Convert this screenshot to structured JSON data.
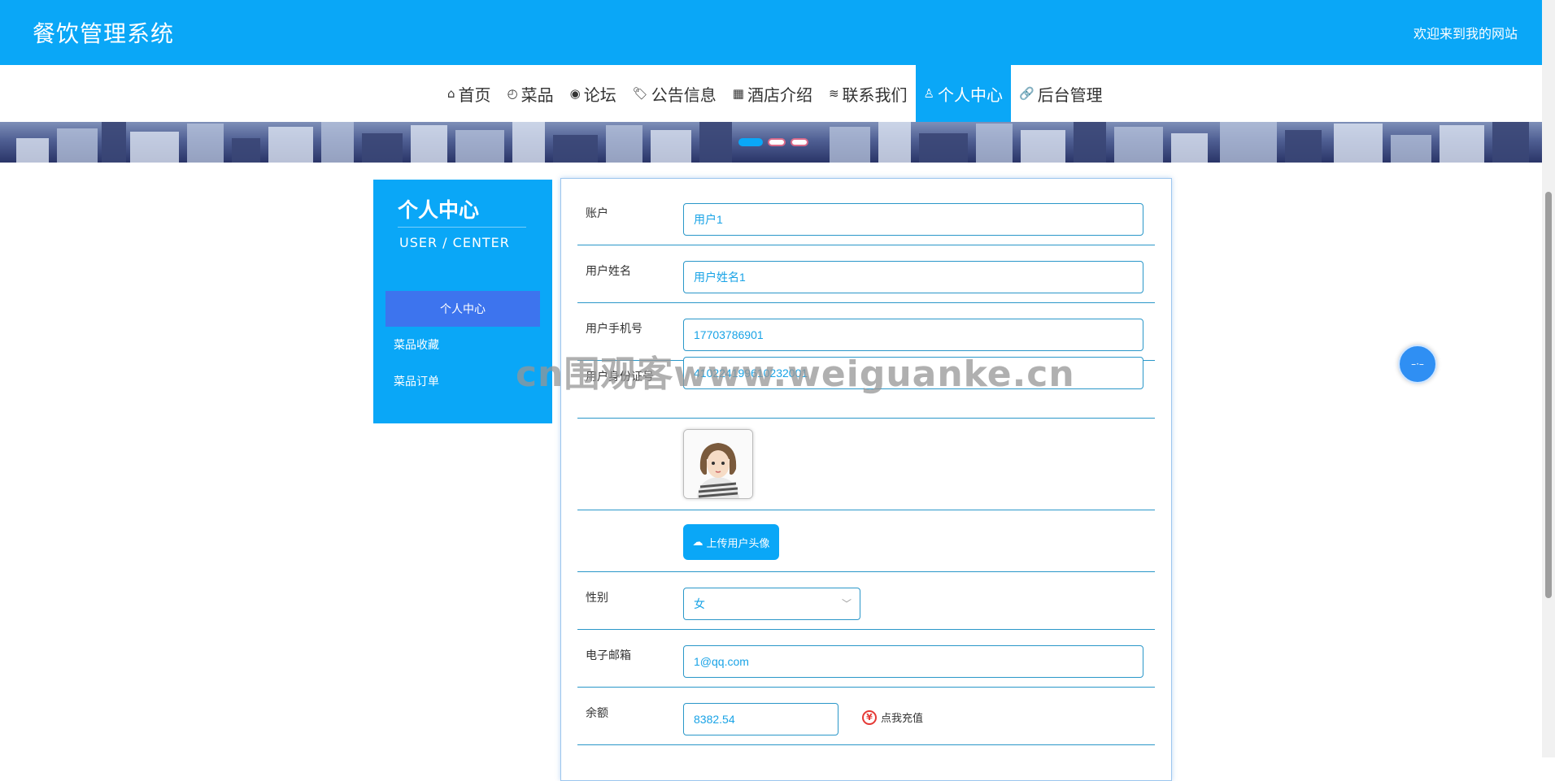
{
  "header": {
    "brand": "餐饮管理系统",
    "welcome": "欢迎来到我的网站"
  },
  "nav": [
    {
      "icon": "⌂",
      "label": "首页"
    },
    {
      "icon": "◴",
      "label": "菜品"
    },
    {
      "icon": "◉",
      "label": "论坛"
    },
    {
      "icon": "🏷",
      "label": "公告信息"
    },
    {
      "icon": "▦",
      "label": "酒店介绍"
    },
    {
      "icon": "≋",
      "label": "联系我们"
    },
    {
      "icon": "♙",
      "label": "个人中心",
      "active": true
    },
    {
      "icon": "🔗",
      "label": "后台管理"
    }
  ],
  "sidebar": {
    "title": "个人中心",
    "subtitle": "USER / CENTER",
    "items": [
      "个人中心",
      "菜品收藏",
      "菜品订单"
    ]
  },
  "form": {
    "account": {
      "label": "账户",
      "value": "用户1"
    },
    "name": {
      "label": "用户姓名",
      "value": "用户姓名1"
    },
    "phone": {
      "label": "用户手机号",
      "value": "17703786901"
    },
    "idcard": {
      "label": "用户身份证号",
      "value": "410224199610232001"
    },
    "upload_label": "上传用户头像",
    "gender": {
      "label": "性别",
      "value": "女"
    },
    "email": {
      "label": "电子邮箱",
      "value": "1@qq.com"
    },
    "balance": {
      "label": "余额",
      "value": "8382.54"
    },
    "recharge_label": "点我充值"
  },
  "watermark": "cn围观客www.weiguanke.cn",
  "icons": {
    "upload": "cloud-upload-icon",
    "recharge": "yen-icon",
    "select": "chevron-down-icon"
  },
  "colors": {
    "primary": "#0aa7f7",
    "active_side": "#3d74ee",
    "field_border": "#2a97c9"
  }
}
